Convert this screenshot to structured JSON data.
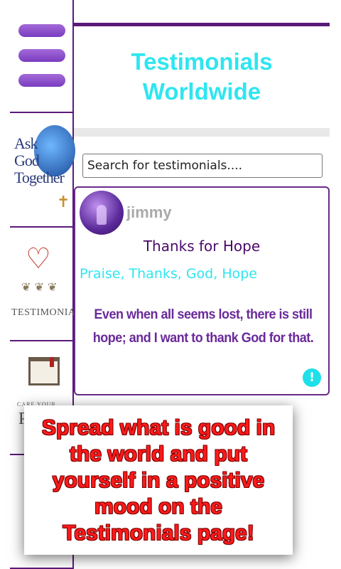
{
  "sidebar": {
    "ask_logo": {
      "lines": [
        "Ask",
        "God",
        "Together"
      ]
    },
    "testimonials_logo": {
      "label": "TESTIMONIALS"
    },
    "book_logo": {
      "caption": "CARE YOUR",
      "letter": "P"
    }
  },
  "header": {
    "title_line1": "Testimonials",
    "title_line2": "Worldwide"
  },
  "search": {
    "placeholder": "Search for testimonials...."
  },
  "testimonial": {
    "author": "jimmy",
    "title": "Thanks for Hope",
    "tags": "Praise, Thanks, God, Hope",
    "body": "Even when all seems lost, there is still hope; and I want to thank God for that.",
    "report_symbol": "!"
  },
  "promo": {
    "text": "Spread what is good in the world and put yourself in a positive mood on the Testimonials page!"
  },
  "colors": {
    "accent_purple": "#5a1a7a",
    "title_cyan": "#2ee6f0",
    "promo_red": "#ff1a1a"
  }
}
